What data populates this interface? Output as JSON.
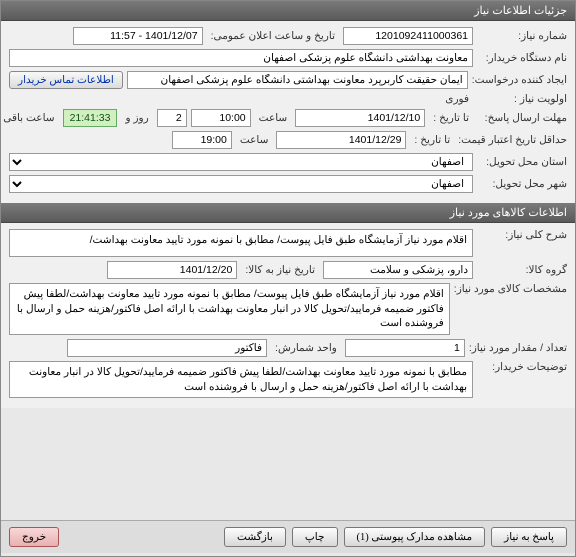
{
  "sections": {
    "need_info_title": "جزئیات اطلاعات نیاز",
    "goods_info_title": "اطلاعات کالاهای مورد نیاز"
  },
  "need": {
    "need_no_label": "شماره نیاز:",
    "need_no": "1201092411000361",
    "announce_label": "تاریخ و ساعت اعلان عمومی:",
    "announce_value": "1401/12/07 - 11:57",
    "buyer_label": "نام دستگاه خریدار:",
    "buyer_value": "معاونت بهداشتی دانشگاه علوم پزشکی اصفهان",
    "creator_label": "ایجاد کننده درخواست:",
    "creator_value": "ایمان حقیقت کاربرپرد معاونت بهداشتی دانشگاه علوم پزشکی اصفهان",
    "contact_btn": "اطلاعات تماس خریدار",
    "priority_label": "اولویت نیاز :",
    "priority_value": "فوری",
    "deadline_label": "مهلت ارسال پاسخ:",
    "from_date_label": "تا تاریخ :",
    "from_date": "1401/12/10",
    "time_label": "ساعت",
    "from_time": "10:00",
    "days_value": "2",
    "days_suffix": "روز و",
    "remaining_time": "21:41:33",
    "remaining_suffix": "ساعت باقی مانده",
    "min_validity_label": "حداقل تاریخ اعتبار قیمت:",
    "to_date_label": "تا تاریخ :",
    "to_date": "1401/12/29",
    "to_time": "19:00",
    "province_label": "استان محل تحویل:",
    "province_value": "اصفهان",
    "city_label": "شهر محل تحویل:",
    "city_value": "اصفهان"
  },
  "goods": {
    "desc_label": "شرح کلی نیاز:",
    "desc_value": "اقلام مورد نیاز آزمایشگاه طبق فایل پیوست/ مطابق با نمونه مورد تایید معاونت بهداشت/",
    "group_label": "گروه کالا:",
    "group_value": "دارو، پزشکی و سلامت",
    "need_date_label": "تاریخ نیاز به کالا:",
    "need_date_value": "1401/12/20",
    "spec_label": "مشخصات کالای مورد نیاز:",
    "spec_value": "اقلام مورد نیاز آزمایشگاه طبق فایل پیوست/ مطابق با نمونه مورد تایید معاونت بهداشت/لطفا پیش فاکتور ضمیمه فرمایید/تحویل کالا در انبار معاونت بهداشت با ارائه اصل فاکتور/هزینه حمل و ارسال با فروشنده است",
    "qty_label": "تعداد / مقدار مورد نیاز:",
    "qty_value": "1",
    "unit_label": "واحد شمارش:",
    "unit_value": "فاکتور",
    "buyer_notes_label": "توضیحات خریدار:",
    "buyer_notes_value": "مطابق با نمونه مورد تایید معاونت بهداشت/لطفا پیش فاکتور ضمیمه فرمایید/تحویل کالا در انبار معاونت بهداشت با ارائه اصل فاکتور/هزینه حمل و ارسال با فروشنده است"
  },
  "buttons": {
    "respond": "پاسخ به نیاز",
    "attachments": "مشاهده مدارک پیوستی (1)",
    "print": "چاپ",
    "back": "بازگشت",
    "exit": "خروج"
  }
}
